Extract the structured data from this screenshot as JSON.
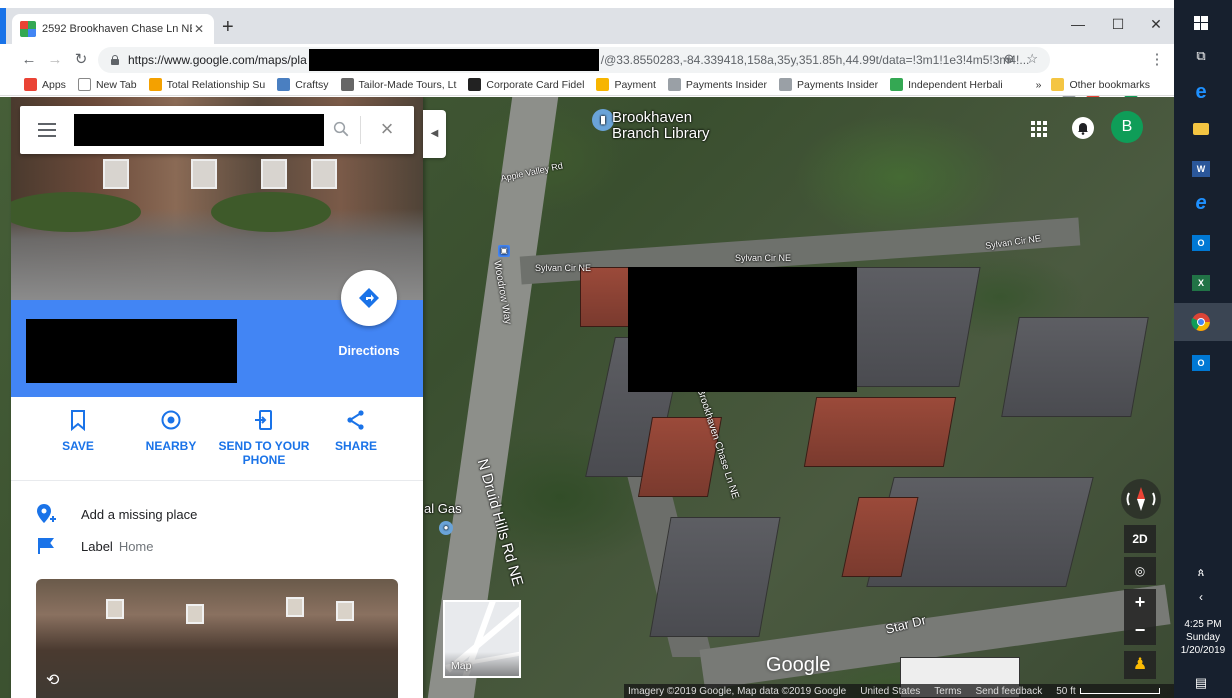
{
  "browser": {
    "tab_title": "2592 Brookhaven Chase Ln NE -",
    "url_prefix": "https://www.google.com/maps/pla",
    "url_suffix": "/@33.8550283,-84.339418,158a,35y,351.85h,44.99t/data=!3m1!1e3!4m5!3m4!...",
    "profile_initial": "B",
    "bookmarks": [
      {
        "label": "Apps",
        "color": "#ea4335"
      },
      {
        "label": "New Tab",
        "color": "#ffffff"
      },
      {
        "label": "Total Relationship Su",
        "color": "#f4a100"
      },
      {
        "label": "Craftsy",
        "color": "#4a7fc1"
      },
      {
        "label": "Tailor-Made Tours, Lt",
        "color": "#666666"
      },
      {
        "label": "Corporate Card Fidel",
        "color": "#222222"
      },
      {
        "label": "Payment",
        "color": "#f7b500"
      },
      {
        "label": "Payments Insider",
        "color": "#9aa0a6"
      },
      {
        "label": "Payments Insider",
        "color": "#9aa0a6"
      },
      {
        "label": "Independent Herbali",
        "color": "#34a853"
      }
    ],
    "more_bookmarks": "»",
    "other_bookmarks": "Other bookmarks"
  },
  "panel": {
    "directions_label": "Directions",
    "actions": [
      {
        "label": "SAVE",
        "icon": "bookmark-icon"
      },
      {
        "label": "NEARBY",
        "icon": "nearby-icon"
      },
      {
        "label": "SEND TO YOUR PHONE",
        "icon": "send-to-phone-icon"
      },
      {
        "label": "SHARE",
        "icon": "share-icon"
      }
    ],
    "add_missing_place": "Add a missing place",
    "label_title": "Label",
    "label_value": "Home"
  },
  "map": {
    "labels": {
      "library": "Brookhaven Branch Library",
      "library_line1": "Brookhaven",
      "library_line2": "Branch Library",
      "apple_valley": "Apple Valley Rd",
      "sylvan_cir_1": "Sylvan Cir NE",
      "sylvan_cir_2": "Sylvan Cir NE",
      "sylvan_cir_3": "Sylvan Cir NE",
      "woodrow": "Woodrow Way",
      "druid_hills": "N Druid Hills Rd NE",
      "brookhaven_chase": "Brookhaven Chase Ln NE",
      "star_dr": "Star Dr",
      "gas": "al Gas"
    },
    "avatar_initial": "B",
    "minimap_label": "Map",
    "view_2d": "2D",
    "zoom_in": "+",
    "zoom_out": "−",
    "google_logo": "Google",
    "footer": {
      "imagery": "Imagery ©2019 Google, Map data ©2019 Google",
      "country": "United States",
      "terms": "Terms",
      "feedback": "Send feedback",
      "scale": "50 ft"
    }
  },
  "taskbar": {
    "time": "4:25 PM",
    "day": "Sunday",
    "date": "1/20/2019"
  }
}
